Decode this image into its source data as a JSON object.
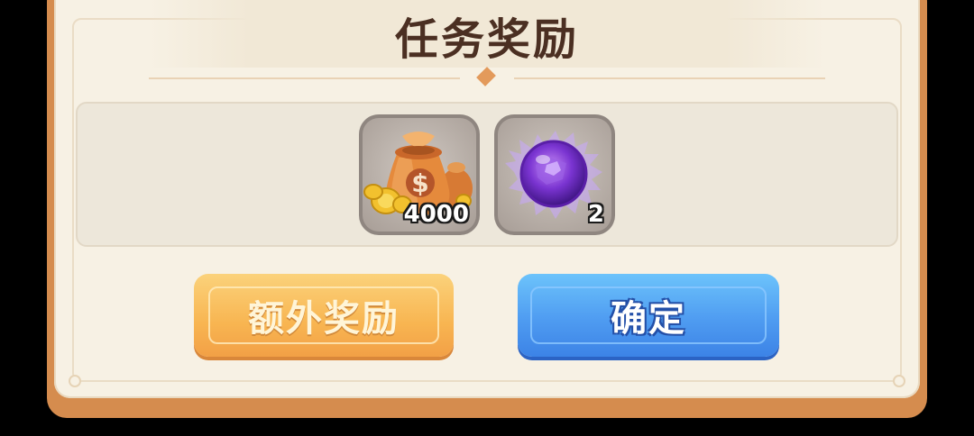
{
  "dialog": {
    "title": "任务奖励"
  },
  "rewards": [
    {
      "icon": "money-bag-icon",
      "count": "4000"
    },
    {
      "icon": "purple-orb-icon",
      "count": "2"
    }
  ],
  "buttons": {
    "extra_label": "额外奖励",
    "confirm_label": "确定"
  },
  "colors": {
    "frame": "#d58c4e",
    "panel": "#f7f1e4",
    "extra_button": "#f8b551",
    "confirm_button": "#4f9cf1",
    "title_text": "#4b2f22"
  }
}
